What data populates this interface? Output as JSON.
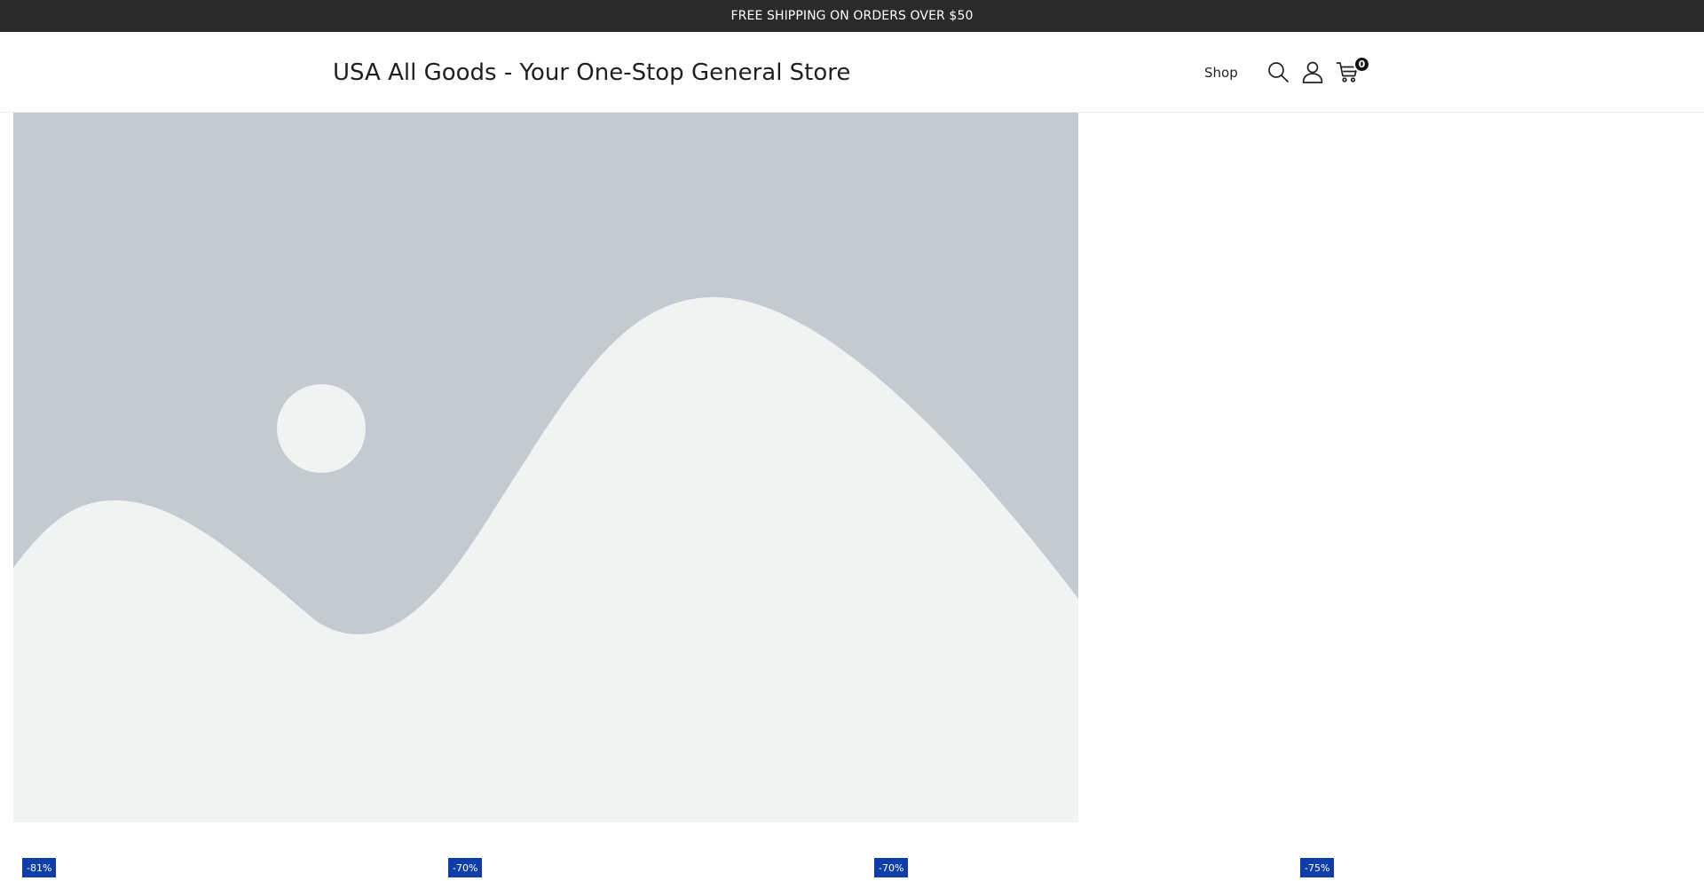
{
  "announcement": {
    "text": "FREE SHIPPING ON ORDERS OVER $50"
  },
  "header": {
    "brand": "USA All Goods - Your One-Stop General Store",
    "nav": [
      {
        "label": "Shop"
      }
    ],
    "icons": {
      "search": "search-icon",
      "account": "account-icon",
      "cart": "cart-icon"
    },
    "cart_count": "0"
  },
  "hero": {
    "image": "placeholder-landscape-image",
    "colors": {
      "sky": "#c3cbd1",
      "land": "#f0f3f4"
    }
  },
  "products": [
    {
      "discount": "-81%"
    },
    {
      "discount": "-70%"
    },
    {
      "discount": "-70%"
    },
    {
      "discount": "-75%"
    }
  ],
  "colors": {
    "announcement_bg": "#2a2a2a",
    "badge_bg": "#0f3ea6",
    "cart_badge_bg": "#111111"
  }
}
